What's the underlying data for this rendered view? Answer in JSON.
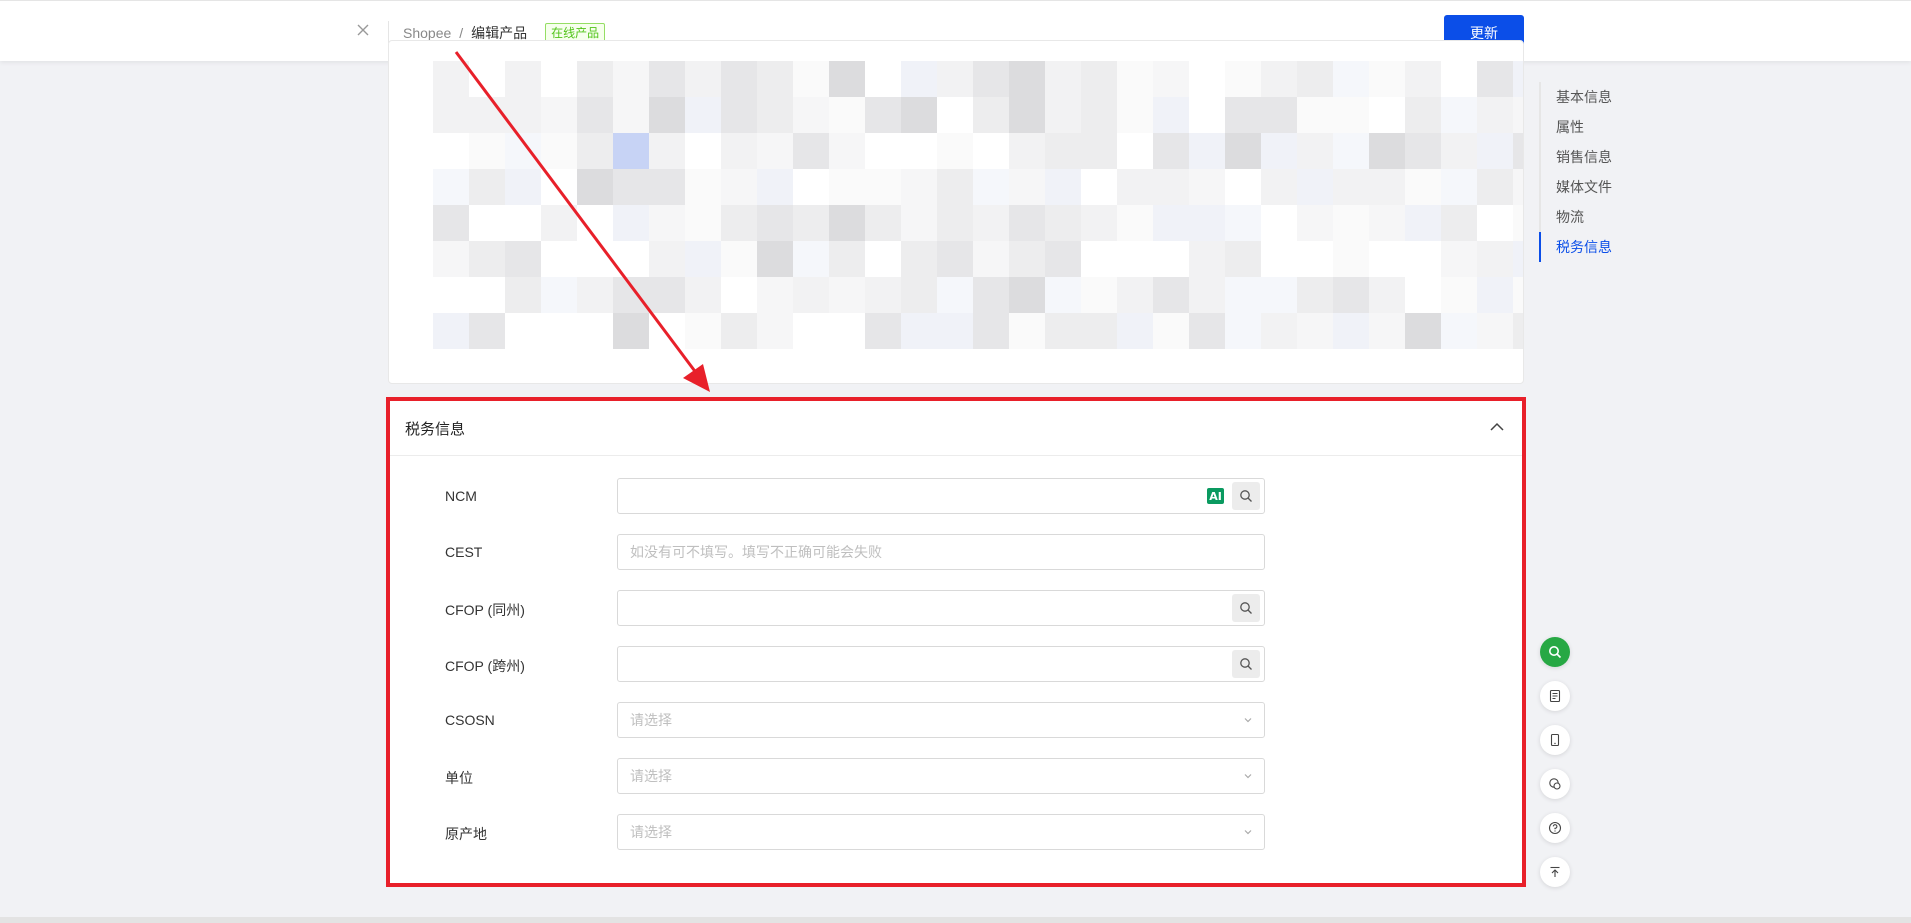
{
  "header": {
    "close_icon": "close-icon",
    "breadcrumb": {
      "root": "Shopee",
      "separator": "/",
      "current": "编辑产品"
    },
    "status_tag": "在线产品",
    "update_button": "更新"
  },
  "side_nav": {
    "items": [
      {
        "label": "基本信息",
        "active": false
      },
      {
        "label": "属性",
        "active": false
      },
      {
        "label": "销售信息",
        "active": false
      },
      {
        "label": "媒体文件",
        "active": false
      },
      {
        "label": "物流",
        "active": false
      },
      {
        "label": "税务信息",
        "active": true
      }
    ]
  },
  "tax_section": {
    "title": "税务信息",
    "collapse_icon": "chevron-up-icon",
    "fields": {
      "ncm": {
        "label": "NCM",
        "value": "",
        "ai_badge": "AI"
      },
      "cest": {
        "label": "CEST",
        "placeholder": "如没有可不填写。填写不正确可能会失败"
      },
      "cfop_same": {
        "label": "CFOP (同州)",
        "value": ""
      },
      "cfop_cross": {
        "label": "CFOP (跨州)",
        "value": ""
      },
      "csosn": {
        "label": "CSOSN",
        "placeholder": "请选择"
      },
      "unit": {
        "label": "单位",
        "placeholder": "请选择"
      },
      "origin": {
        "label": "原产地",
        "placeholder": "请选择"
      }
    }
  },
  "float_tools": [
    "search-icon",
    "form-icon",
    "mobile-icon",
    "chat-icon",
    "help-icon",
    "back-to-top-icon"
  ],
  "colors": {
    "primary": "#0b4ee8",
    "annotation_red": "#e8202a",
    "online_green": "#52c41a",
    "ai_green": "#0a9a60",
    "search_float_green": "#27a844"
  }
}
